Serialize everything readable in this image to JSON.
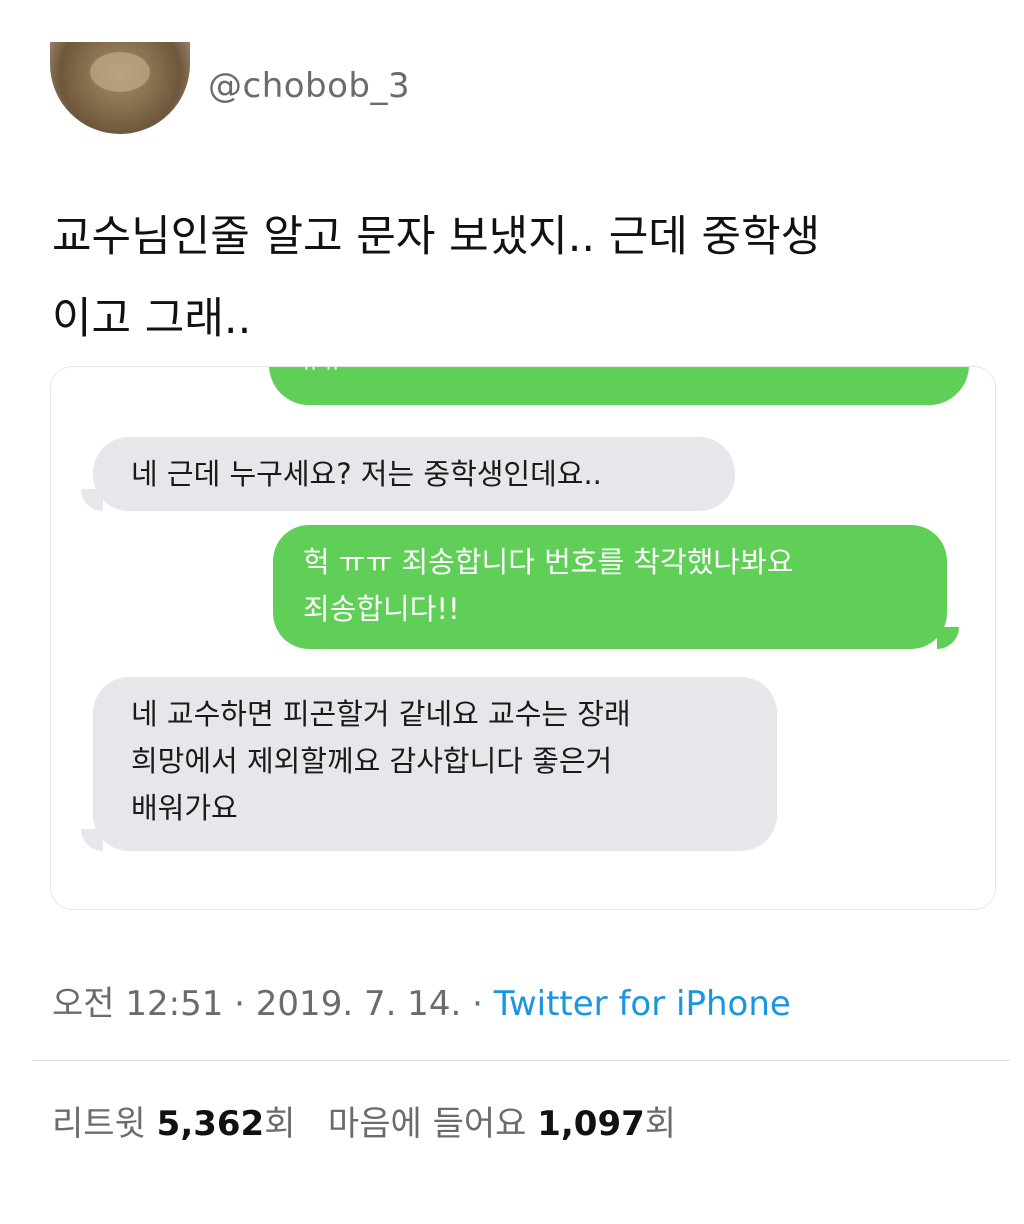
{
  "author": {
    "handle": "@chobob_3"
  },
  "tweet": {
    "text": "교수님인줄 알고 문자 보냈지.. 근데 중학생\n이고 그래.."
  },
  "messages": [
    {
      "side": "outgoing",
      "text": "ㅠㅠ",
      "cut_off": true
    },
    {
      "side": "incoming",
      "text": "네 근데 누구세요? 저는 중학생인데요.."
    },
    {
      "side": "outgoing",
      "text": "헉 ㅠㅠ 죄송합니다 번호를 착각했나봐요\n죄송합니다!!"
    },
    {
      "side": "incoming",
      "text": "네 교수하면 피곤할거 같네요 교수는 장래\n희망에서 제외할께요 감사합니다 좋은거\n배워가요"
    }
  ],
  "meta": {
    "time": "오전 12:51",
    "separator1": " · ",
    "date": "2019. 7. 14.",
    "separator2": " · ",
    "source": "Twitter for iPhone"
  },
  "stats": {
    "retweet_label": "리트윗",
    "retweet_count": "5,362",
    "retweet_unit": "회",
    "like_label": "마음에 들어요",
    "like_count": "1,097",
    "like_unit": "회"
  },
  "colors": {
    "incoming_bubble": "#e6e6eb",
    "outgoing_bubble": "#5fcf58",
    "link": "#1b95e0"
  }
}
